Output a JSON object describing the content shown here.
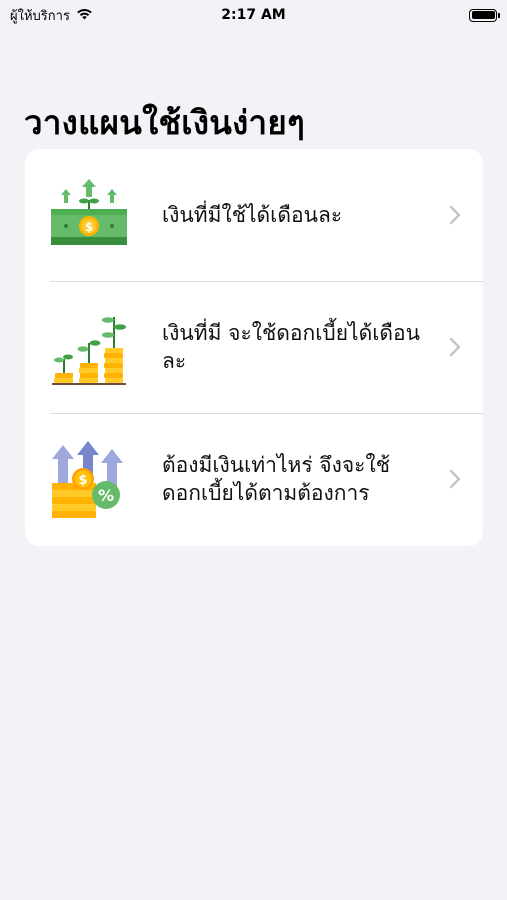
{
  "status_bar": {
    "carrier": "ผู้ให้บริการ",
    "time": "2:17 AM"
  },
  "page": {
    "title": "วางแผนใช้เงินง่ายๆ"
  },
  "menu": {
    "items": [
      {
        "label": "เงินที่มีใช้ได้เดือนละ",
        "icon": "money-growth-icon"
      },
      {
        "label": "เงินที่มี จะใช้ดอกเบี้ยได้เดือนละ",
        "icon": "coin-plants-icon"
      },
      {
        "label": "ต้องมีเงินเท่าไหร่ จึงจะใช้ดอกเบี้ยได้ตามต้องการ",
        "icon": "coins-percent-icon"
      }
    ]
  },
  "colors": {
    "background": "#f2f2f7",
    "card": "#ffffff",
    "chevron": "#c4c4c9"
  }
}
